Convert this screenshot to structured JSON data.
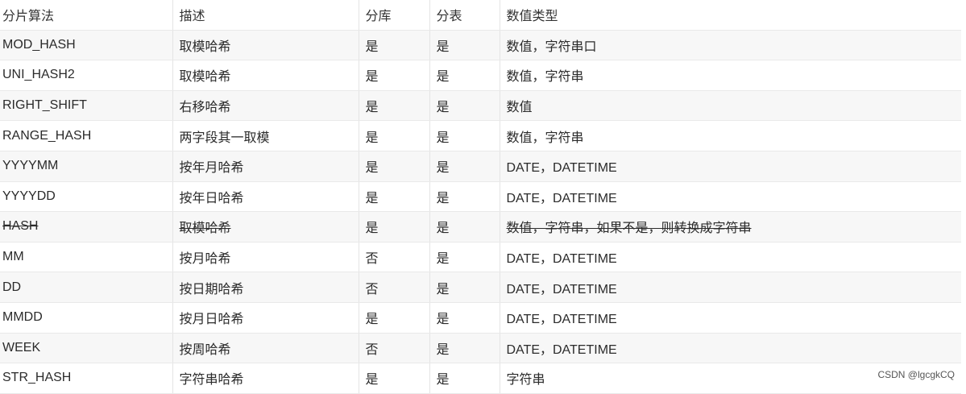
{
  "table": {
    "headers": [
      "分片算法",
      "描述",
      "分库",
      "分表",
      "数值类型"
    ],
    "rows": [
      {
        "algo": "MOD_HASH",
        "desc": "取模哈希",
        "db": "是",
        "tb": "是",
        "type": "数值，字符串口",
        "strike": false
      },
      {
        "algo": "UNI_HASH2",
        "desc": "取模哈希",
        "db": "是",
        "tb": "是",
        "type": "数值，字符串",
        "strike": false
      },
      {
        "algo": "RIGHT_SHIFT",
        "desc": "右移哈希",
        "db": "是",
        "tb": "是",
        "type": "数值",
        "strike": false
      },
      {
        "algo": "RANGE_HASH",
        "desc": "两字段其一取模",
        "db": "是",
        "tb": "是",
        "type": "数值，字符串",
        "strike": false
      },
      {
        "algo": "YYYYMM",
        "desc": "按年月哈希",
        "db": "是",
        "tb": "是",
        "type": "DATE，DATETIME",
        "strike": false
      },
      {
        "algo": "YYYYDD",
        "desc": "按年日哈希",
        "db": "是",
        "tb": "是",
        "type": "DATE，DATETIME",
        "strike": false
      },
      {
        "algo": "HASH",
        "desc": "取模哈希",
        "db": "是",
        "tb": "是",
        "type": "数值，字符串，如果不是，则转换成字符串",
        "strike": true
      },
      {
        "algo": "MM",
        "desc": "按月哈希",
        "db": "否",
        "tb": "是",
        "type": "DATE，DATETIME",
        "strike": false
      },
      {
        "algo": "DD",
        "desc": "按日期哈希",
        "db": "否",
        "tb": "是",
        "type": "DATE，DATETIME",
        "strike": false
      },
      {
        "algo": "MMDD",
        "desc": "按月日哈希",
        "db": "是",
        "tb": "是",
        "type": "DATE，DATETIME",
        "strike": false
      },
      {
        "algo": "WEEK",
        "desc": "按周哈希",
        "db": "否",
        "tb": "是",
        "type": "DATE，DATETIME",
        "strike": false
      },
      {
        "algo": "STR_HASH",
        "desc": "字符串哈希",
        "db": "是",
        "tb": "是",
        "type": "字符串",
        "strike": false
      }
    ]
  },
  "watermark": "CSDN @lgcgkCQ"
}
